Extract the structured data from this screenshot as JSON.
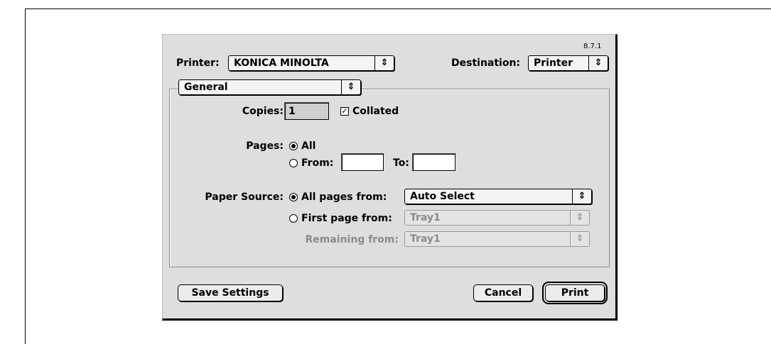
{
  "version": "8.7.1",
  "printer": {
    "label": "Printer:",
    "value": "KONICA MINOLTA"
  },
  "destination": {
    "label": "Destination:",
    "value": "Printer"
  },
  "panel": {
    "value": "General"
  },
  "copies": {
    "label": "Copies:",
    "value": "1",
    "collated_label": "Collated",
    "collated_checked": true,
    "check_glyph": "✓"
  },
  "pages": {
    "label": "Pages:",
    "all_label": "All",
    "from_label": "From:",
    "to_label": "To:",
    "from_value": "",
    "to_value": "",
    "selected": "All"
  },
  "paper_source": {
    "label": "Paper Source:",
    "all_pages_label": "All pages from:",
    "all_pages_value": "Auto Select",
    "first_page_label": "First page from:",
    "first_page_value": "Tray1",
    "remaining_label": "Remaining from:",
    "remaining_value": "Tray1",
    "selected": "All pages from"
  },
  "buttons": {
    "save_settings": "Save Settings",
    "cancel": "Cancel",
    "print": "Print"
  },
  "icons": {
    "popup_arrows": "⇕"
  }
}
